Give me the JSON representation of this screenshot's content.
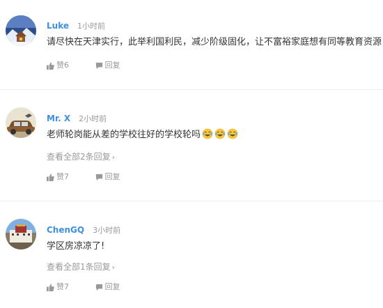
{
  "comments": [
    {
      "name": "Luke",
      "time": "1小时前",
      "text": "请尽快在天津实行，此举利国利民，减少阶级固化，让不富裕家庭想有同等教育资源",
      "like_label": "赞6",
      "reply_label": "回复",
      "avatar_icon": "snowy-cabin-avatar"
    },
    {
      "name": "Mr. X",
      "time": "2小时前",
      "text": "老师轮岗能从差的学校往好的学校轮吗",
      "emojis": [
        "laughing-tears-emoji",
        "laughing-tears-emoji",
        "laughing-tears-emoji"
      ],
      "view_replies": "查看全部2条回复",
      "like_label": "赞7",
      "reply_label": "回复",
      "avatar_icon": "car-avatar"
    },
    {
      "name": "ChenGQ",
      "time": "3小时前",
      "text": "学区房凉凉了!",
      "view_replies": "查看全部1条回复",
      "like_label": "赞7",
      "reply_label": "回复",
      "avatar_icon": "palace-avatar"
    }
  ],
  "colors": {
    "name": "#3d8fe0",
    "muted": "#999999",
    "text": "#333333",
    "divider": "#eeeeee",
    "emoji_face": "#f5c542"
  }
}
